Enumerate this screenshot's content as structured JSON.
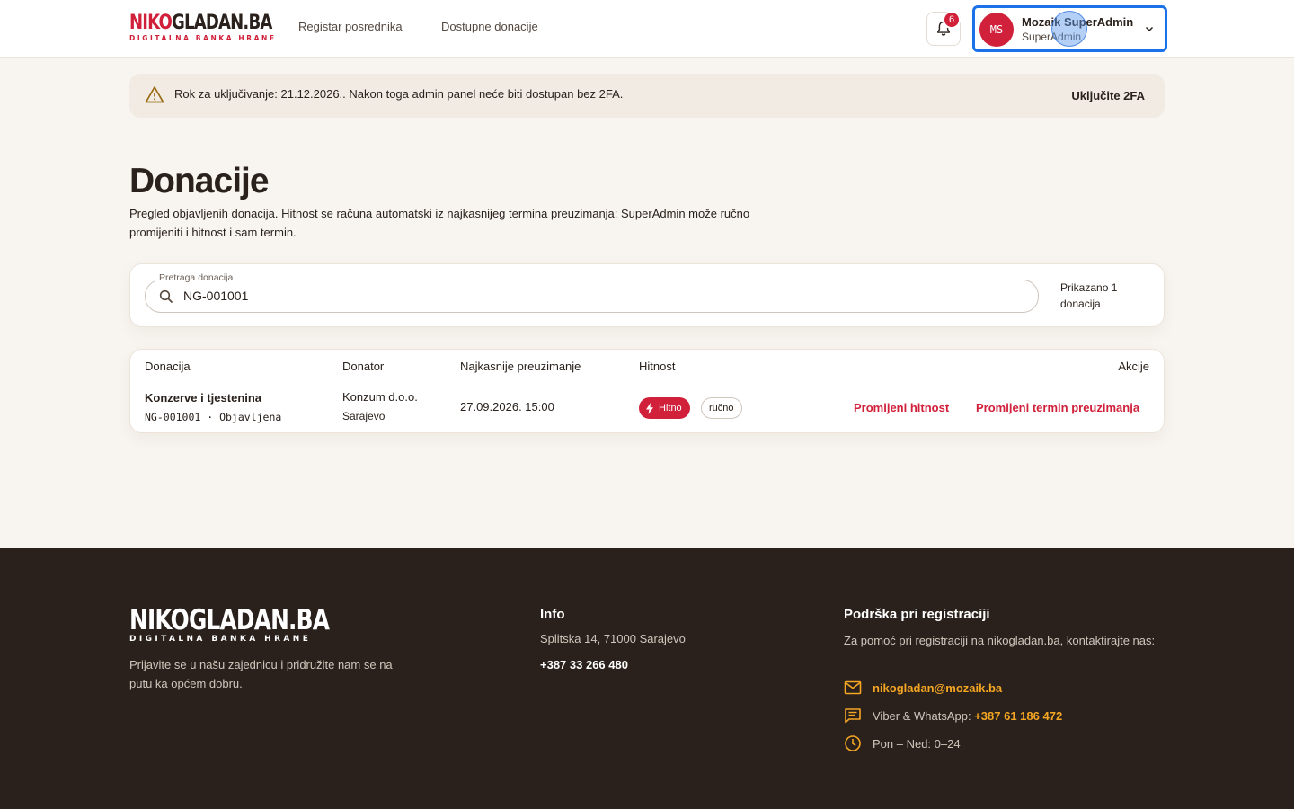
{
  "header": {
    "logo_part1": "NIKO",
    "logo_part2": "GLADAN.BA",
    "logo_sub": "DIGITALNA BANKA HRANE",
    "nav": [
      "Registar posrednika",
      "Dostupne donacije"
    ],
    "notifications_count": "6",
    "user": {
      "initials": "MS",
      "name": "Mozaik SuperAdmin",
      "role": "SuperAdmin"
    }
  },
  "alert": {
    "text": "Rok za uključivanje: 21.12.2026.. Nakon toga admin panel neće biti dostupan bez 2FA.",
    "action": "Uključite 2FA"
  },
  "page": {
    "title": "Donacije",
    "description": "Pregled objavljenih donacija. Hitnost se računa automatski iz najkasnijeg termina preuzimanja; SuperAdmin može ručno promijeniti i hitnost i sam termin."
  },
  "search": {
    "label": "Pretraga donacija",
    "value": "NG-001001",
    "count": "Prikazano 1 donacija"
  },
  "table": {
    "headers": {
      "donation": "Donacija",
      "donor": "Donator",
      "pickup": "Najkasnije preuzimanje",
      "urgency": "Hitnost",
      "actions": "Akcije"
    },
    "rows": [
      {
        "title": "Konzerve i tjestenina",
        "code": "NG-001001 · Objavljena",
        "donor": "Konzum d.o.o.",
        "city": "Sarajevo",
        "pickup": "27.09.2026. 15:00",
        "urgency": "Hitno",
        "mode": "ručno",
        "action1": "Promijeni hitnost",
        "action2": "Promijeni termin preuzimanja"
      }
    ]
  },
  "footer": {
    "logo": "NIKOGLADAN.BA",
    "logo_sub": "DIGITALNA BANKA HRANE",
    "tagline": "Prijavite se u našu zajednicu i pridružite nam se na putu ka općem dobru.",
    "info_title": "Info",
    "address": "Splitska 14, 71000 Sarajevo",
    "phone": "+387 33 266 480",
    "support_title": "Podrška pri registraciji",
    "support_text": "Za pomoć pri registraciji na nikogladan.ba, kontaktirajte nas:",
    "email": "nikogladan@mozaik.ba",
    "viber_label": "Viber & WhatsApp:",
    "viber_phone": "+387 61 186 472",
    "hours": "Pon – Ned: 0–24"
  },
  "colors": {
    "brand_red": "#d0203a",
    "footer_bg": "#2a211c",
    "accent_orange": "#f5a623",
    "focus_blue": "#1b72e8"
  }
}
